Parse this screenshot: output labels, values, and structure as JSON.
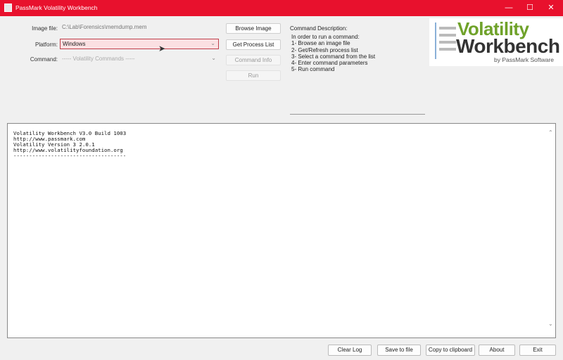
{
  "window": {
    "title": "PassMark Volatility Workbench",
    "minimize": "—",
    "maximize": "☐",
    "close": "✕"
  },
  "form": {
    "image_label": "Image file:",
    "image_value": "C:\\Lab\\Forensics\\memdump.mem",
    "platform_label": "Platform:",
    "platform_value": "Windows",
    "command_label": "Command:",
    "command_value": "----- Volatility Commands -----"
  },
  "buttons": {
    "browse": "Browse Image",
    "process_list": "Get Process List",
    "command_info": "Command Info",
    "run": "Run"
  },
  "description": {
    "label": "Command Description:",
    "lines": [
      "In order to run a command:",
      "1- Browse an image file",
      "2- Get/Refresh process list",
      "3- Select a command from the list",
      "4- Enter command parameters",
      "5- Run command"
    ]
  },
  "logo": {
    "line1": "Volatility",
    "line2": "Workbench",
    "byline": "by PassMark Software"
  },
  "log": {
    "text": "Volatility Workbench V3.0 Build 1003\nhttp://www.passmark.com\nVolatility Version 3 2.0.1\nhttp://www.volatilityfoundation.org\n------------------------------------"
  },
  "footer": {
    "clear": "Clear Log",
    "save": "Save to file",
    "copy": "Copy to clipboard",
    "about": "About",
    "exit": "Exit"
  }
}
